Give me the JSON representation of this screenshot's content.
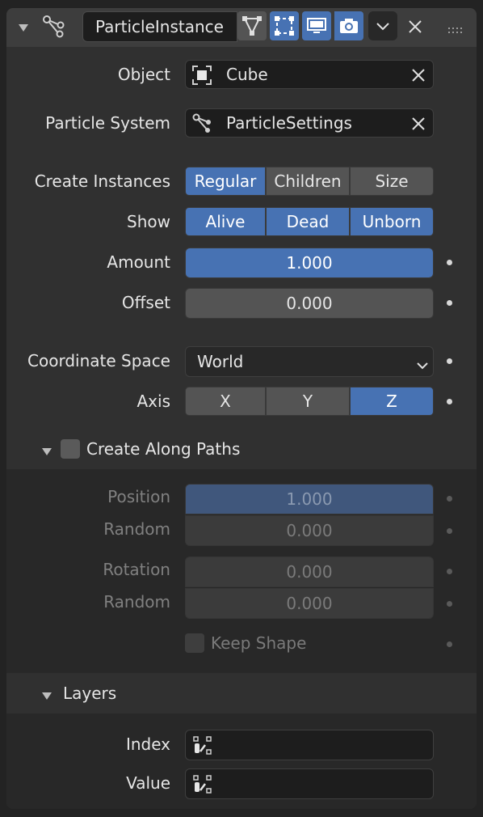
{
  "modifier": {
    "name": "ParticleInstance",
    "icons": [
      "collapse-arrow-icon",
      "particle-instance-modifier-icon",
      "edit-mode-icon",
      "on-cage-icon",
      "viewport-display-icon",
      "render-icon",
      "dropdown-chevron-icon",
      "close-icon",
      "drag-handle-icon"
    ]
  },
  "object": {
    "label": "Object",
    "value": "Cube"
  },
  "particle_system": {
    "label": "Particle System",
    "value": "ParticleSettings"
  },
  "create_instances": {
    "label": "Create Instances",
    "options": [
      "Regular",
      "Children",
      "Size"
    ],
    "active": [
      "Regular"
    ]
  },
  "show": {
    "label": "Show",
    "options": [
      "Alive",
      "Dead",
      "Unborn"
    ],
    "active": [
      "Alive",
      "Dead",
      "Unborn"
    ]
  },
  "amount": {
    "label": "Amount",
    "value": "1.000"
  },
  "offset": {
    "label": "Offset",
    "value": "0.000"
  },
  "coordinate_space": {
    "label": "Coordinate Space",
    "value": "World"
  },
  "axis": {
    "label": "Axis",
    "options": [
      "X",
      "Y",
      "Z"
    ],
    "active": "Z"
  },
  "create_along_paths": {
    "title": "Create Along Paths",
    "enabled": false,
    "position": {
      "label": "Position",
      "value": "1.000"
    },
    "position_random": {
      "label": "Random",
      "value": "0.000"
    },
    "rotation": {
      "label": "Rotation",
      "value": "0.000"
    },
    "rotation_random": {
      "label": "Random",
      "value": "0.000"
    },
    "keep_shape": {
      "label": "Keep Shape",
      "checked": false
    }
  },
  "layers": {
    "title": "Layers",
    "index": {
      "label": "Index",
      "value": ""
    },
    "value": {
      "label": "Value",
      "value": ""
    }
  },
  "colors": {
    "accent": "#4772b3",
    "panel": "#303030",
    "field": "#1d1d1d"
  }
}
